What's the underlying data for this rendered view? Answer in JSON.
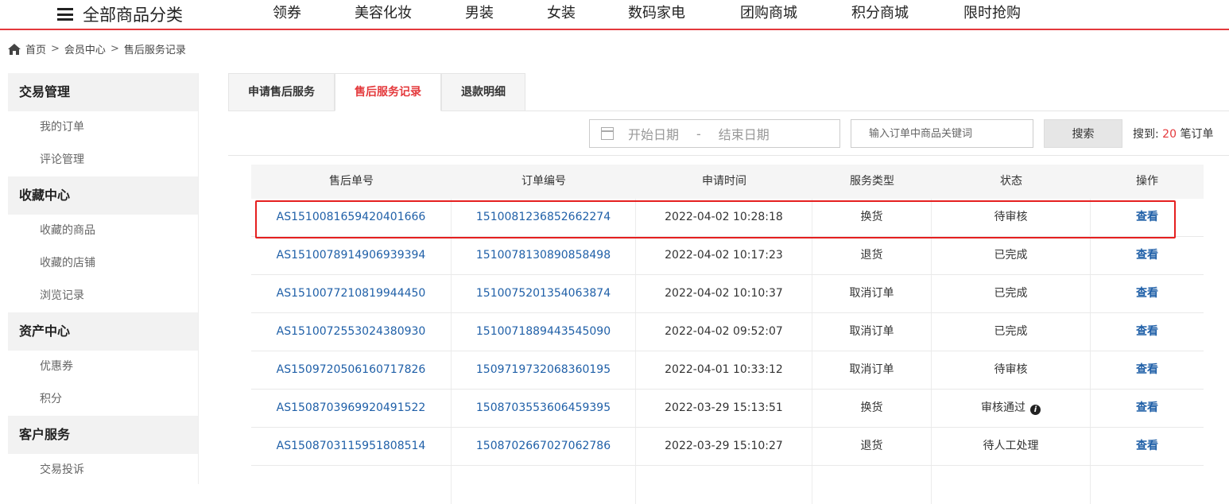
{
  "nav": {
    "all_categories": "全部商品分类",
    "links": [
      "领券",
      "美容化妆",
      "男装",
      "女装",
      "数码家电",
      "团购商城",
      "积分商城",
      "限时抢购"
    ]
  },
  "breadcrumb": [
    "首页",
    "会员中心",
    "售后服务记录"
  ],
  "sidebar": [
    {
      "title": "交易管理",
      "items": [
        "我的订单",
        "评论管理"
      ]
    },
    {
      "title": "收藏中心",
      "items": [
        "收藏的商品",
        "收藏的店铺",
        "浏览记录"
      ]
    },
    {
      "title": "资产中心",
      "items": [
        "优惠券",
        "积分"
      ]
    },
    {
      "title": "客户服务",
      "items": [
        "交易投诉"
      ]
    }
  ],
  "tabs": [
    {
      "label": "申请售后服务",
      "active": false
    },
    {
      "label": "售后服务记录",
      "active": true
    },
    {
      "label": "退款明细",
      "active": false
    }
  ],
  "search": {
    "start_placeholder": "开始日期",
    "end_placeholder": "结束日期",
    "range_sep": "-",
    "keyword_placeholder": "输入订单中商品关键词",
    "button": "搜索",
    "result_prefix": "搜到:",
    "result_count": "20",
    "result_suffix": "笔订单"
  },
  "table": {
    "headers": [
      "售后单号",
      "订单编号",
      "申请时间",
      "服务类型",
      "状态",
      "操作"
    ],
    "rows": [
      {
        "service_no": "AS1510081659420401666",
        "order_no": "1510081236852662274",
        "time": "2022-04-02 10:28:18",
        "type": "换货",
        "status": "待审核",
        "info": false,
        "action": "查看"
      },
      {
        "service_no": "AS1510078914906939394",
        "order_no": "1510078130890858498",
        "time": "2022-04-02 10:17:23",
        "type": "退货",
        "status": "已完成",
        "info": false,
        "action": "查看"
      },
      {
        "service_no": "AS1510077210819944450",
        "order_no": "1510075201354063874",
        "time": "2022-04-02 10:10:37",
        "type": "取消订单",
        "status": "已完成",
        "info": false,
        "action": "查看"
      },
      {
        "service_no": "AS1510072553024380930",
        "order_no": "1510071889443545090",
        "time": "2022-04-02 09:52:07",
        "type": "取消订单",
        "status": "已完成",
        "info": false,
        "action": "查看"
      },
      {
        "service_no": "AS1509720506160717826",
        "order_no": "1509719732068360195",
        "time": "2022-04-01 10:33:12",
        "type": "取消订单",
        "status": "待审核",
        "info": false,
        "action": "查看"
      },
      {
        "service_no": "AS1508703969920491522",
        "order_no": "1508703553606459395",
        "time": "2022-03-29 15:13:51",
        "type": "换货",
        "status": "审核通过",
        "info": true,
        "action": "查看"
      },
      {
        "service_no": "AS1508703115951808514",
        "order_no": "1508702667027062786",
        "time": "2022-03-29 15:10:27",
        "type": "退货",
        "status": "待人工处理",
        "info": false,
        "action": "查看"
      }
    ]
  },
  "colors": {
    "accent": "#e4393c",
    "link": "#2060a8",
    "highlight": "#e52020"
  }
}
